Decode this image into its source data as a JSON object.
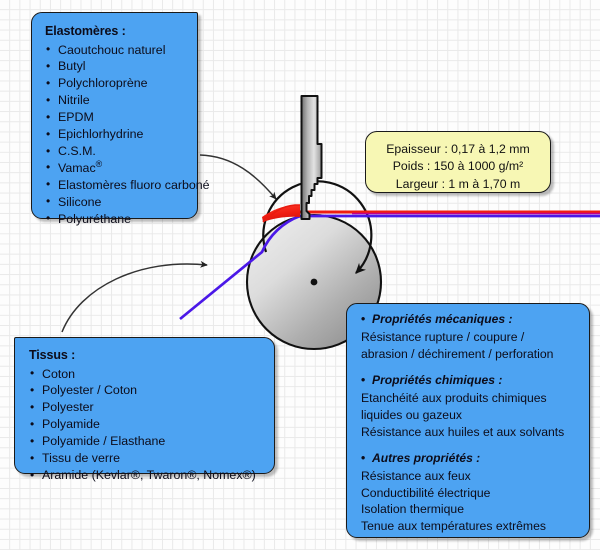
{
  "colors": {
    "box_blue": "#4da3f2",
    "box_yellow": "#f7f7b4",
    "rubber_red": "#f22020",
    "fabric_purple": "#4b18e8",
    "sheet_magenta": "#cc0088",
    "roller_gray": "#a8a8a8",
    "outline_black": "#111111",
    "grid_line": "#e9e9e9",
    "background": "#fdfdfd"
  },
  "elastomeres": {
    "title": "Elastomères :",
    "items": [
      {
        "text": "Caoutchouc naturel"
      },
      {
        "text": "Butyl"
      },
      {
        "text": "Polychloroprène"
      },
      {
        "text": "Nitrile"
      },
      {
        "text": "EPDM"
      },
      {
        "text": "Epichlorhydrine"
      },
      {
        "text": "C.S.M."
      },
      {
        "text": "Vamac",
        "sup": "®"
      },
      {
        "text": "Elastomères fluoro carboné"
      },
      {
        "text": "Silicone"
      },
      {
        "text": "Polyuréthane"
      }
    ]
  },
  "tissus": {
    "title": "Tissus :",
    "items": [
      {
        "text": "Coton"
      },
      {
        "text": "Polyester / Coton"
      },
      {
        "text": "Polyester"
      },
      {
        "text": "Polyamide"
      },
      {
        "text": "Polyamide / Elasthane"
      },
      {
        "text": "Tissu de verre"
      },
      {
        "text": "Aramide (Kevlar®, Twaron®, Nomex®)"
      }
    ]
  },
  "dimensions": {
    "lines": [
      "Epaisseur : 0,17 à 1,2 mm",
      "Poids : 150 à 1000 g/m²",
      "Largeur : 1 m à 1,70 m"
    ]
  },
  "proprietes": {
    "groups": [
      {
        "heading": "Propriétés mécaniques :",
        "lines": [
          "Résistance rupture / coupure /",
          "abrasion / déchirement / perforation"
        ]
      },
      {
        "heading": "Propriétés chimiques :",
        "lines": [
          "Etanchéité aux produits chimiques",
          "liquides ou gazeux",
          "Résistance aux huiles et aux solvants"
        ]
      },
      {
        "heading": "Autres propriétés :",
        "lines": [
          "Résistance aux feux",
          "Conductibilité électrique",
          "Isolation thermique",
          "Tenue aux températures extrêmes"
        ]
      }
    ]
  },
  "diagram": {
    "elements": [
      "doctor-blade",
      "rubber-compound-wedge",
      "calender-roller",
      "rotation-arrow",
      "roller-axis-dot",
      "fabric-web-line",
      "coated-sheet-line",
      "arrow-elastomer-to-rubber",
      "arrow-fabric-to-web"
    ]
  }
}
